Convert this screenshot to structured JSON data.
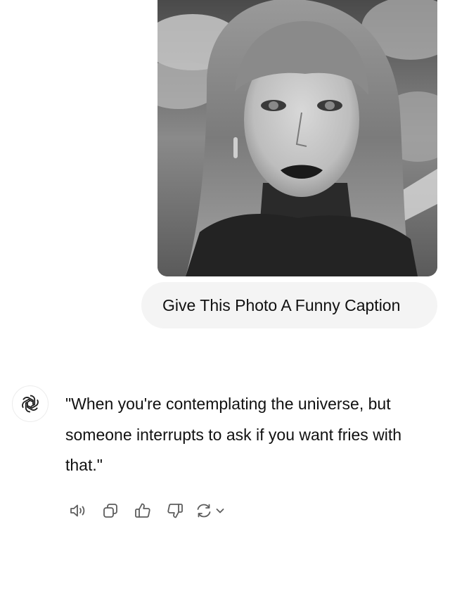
{
  "conversation": {
    "user_message": {
      "image_alt": "photo-attachment",
      "text": "Give This Photo A Funny Caption"
    },
    "assistant_message": {
      "text": "\"When you're contemplating the universe, but someone interrupts to ask if you want fries with that.\""
    },
    "actions": [
      {
        "icon": "speaker-icon"
      },
      {
        "icon": "copy-icon"
      },
      {
        "icon": "thumbs-up-icon"
      },
      {
        "icon": "thumbs-down-icon"
      },
      {
        "icon": "regenerate-icon"
      },
      {
        "icon": "chevron-down-icon"
      }
    ]
  },
  "colors": {
    "bubble_bg": "#f4f4f4",
    "text": "#111111",
    "icon": "#5d5d5d"
  }
}
